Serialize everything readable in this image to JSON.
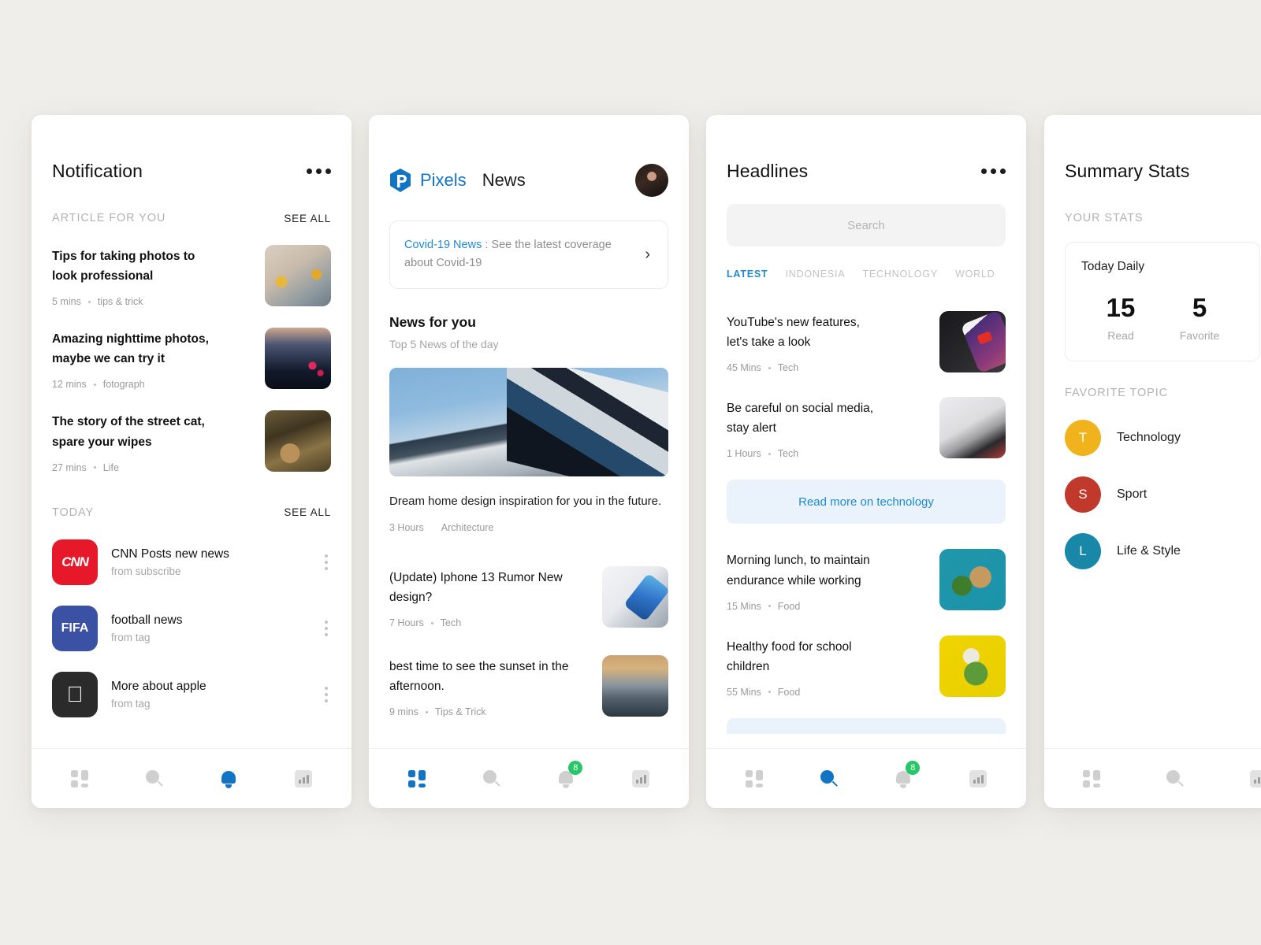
{
  "panel1": {
    "title": "Notification",
    "more_icon": "more-horizontal-icon",
    "sections": [
      {
        "label": "ARTICLE FOR YOU",
        "see_all": "SEE ALL"
      },
      {
        "label": "TODAY",
        "see_all": "SEE ALL"
      }
    ],
    "articles": [
      {
        "title": "Tips for taking photos to look professional",
        "time": "5 mins",
        "category": "tips & trick",
        "thumb": "sunflower-camera-photo"
      },
      {
        "title": "Amazing nighttime photos, maybe we can try it",
        "time": "12 mins",
        "category": "fotograph",
        "thumb": "night-city-phone-photo"
      },
      {
        "title": "The story of the street cat, spare your wipes",
        "time": "27 mins",
        "category": "Life",
        "thumb": "street-cat-photo"
      }
    ],
    "sources": [
      {
        "logo": "CNN",
        "logo_name": "cnn-logo",
        "title": "CNN Posts new news",
        "sub": "from subscribe"
      },
      {
        "logo": "FIFA",
        "logo_name": "fifa-logo",
        "title": "football news",
        "sub": "from tag"
      },
      {
        "logo": "",
        "logo_name": "apple-logo",
        "title": "More about apple",
        "sub": "from tag"
      }
    ],
    "nav": [
      {
        "icon": "grid-icon",
        "active": false,
        "badge": ""
      },
      {
        "icon": "search-icon",
        "active": false,
        "badge": ""
      },
      {
        "icon": "bell-icon",
        "active": true,
        "badge": ""
      },
      {
        "icon": "chart-icon",
        "active": false,
        "badge": ""
      }
    ]
  },
  "panel2": {
    "brand_logo": "pixels-hexagon-logo",
    "brand_first": "Pixels",
    "brand_second": "News",
    "avatar": "user-avatar",
    "covid": {
      "link": "Covid-19 News",
      "rest": " : See the latest coverage about Covid-19",
      "chevron": "chevron-right-icon"
    },
    "news_title": "News for you",
    "news_sub": "Top 5 News of the day",
    "hero": {
      "image": "modern-building-architecture-photo",
      "caption": "Dream home design inspiration for you in the future.",
      "time": "3 Hours",
      "category": "Architecture"
    },
    "articles": [
      {
        "title": "(Update) Iphone 13 Rumor New design?",
        "time": "7 Hours",
        "category": "Tech",
        "thumb": "iphone-on-laptop-photo"
      },
      {
        "title": "best time to see the sunset in the afternoon.",
        "time": "9 mins",
        "category": "Tips & Trick",
        "thumb": "sunset-mountains-photo"
      }
    ],
    "nav": [
      {
        "icon": "grid-icon",
        "active": true,
        "badge": ""
      },
      {
        "icon": "search-icon",
        "active": false,
        "badge": ""
      },
      {
        "icon": "bell-icon",
        "active": false,
        "badge": "8"
      },
      {
        "icon": "chart-icon",
        "active": false,
        "badge": ""
      }
    ]
  },
  "panel3": {
    "title": "Headlines",
    "more_icon": "more-horizontal-icon",
    "search_placeholder": "Search",
    "tabs": [
      {
        "label": "LATEST",
        "active": true
      },
      {
        "label": "INDONESIA",
        "active": false
      },
      {
        "label": "TECHNOLOGY",
        "active": false
      },
      {
        "label": "WORLD",
        "active": false
      }
    ],
    "articles_top": [
      {
        "title": "YouTube's new features, let's take a look",
        "time": "45 Mins",
        "category": "Tech",
        "thumb": "youtube-on-phone-photo"
      },
      {
        "title": "Be careful on social media, stay alert",
        "time": "1 Hours",
        "category": "Tech",
        "thumb": "social-media-tablet-photo"
      }
    ],
    "read_more_tech": "Read more on technology",
    "articles_bottom": [
      {
        "title": "Morning lunch, to maintain endurance while working",
        "time": "15 Mins",
        "category": "Food",
        "thumb": "lunch-box-photo"
      },
      {
        "title": "Healthy food for school children",
        "time": "55 Mins",
        "category": "Food",
        "thumb": "healthy-food-photo"
      }
    ],
    "nav": [
      {
        "icon": "grid-icon",
        "active": false,
        "badge": ""
      },
      {
        "icon": "search-icon",
        "active": true,
        "badge": ""
      },
      {
        "icon": "bell-icon",
        "active": false,
        "badge": "8"
      },
      {
        "icon": "chart-icon",
        "active": false,
        "badge": ""
      }
    ]
  },
  "panel4": {
    "title": "Summary Stats",
    "stats_label": "YOUR STATS",
    "card_title": "Today Daily",
    "stats": [
      {
        "value": "15",
        "caption": "Read"
      },
      {
        "value": "5",
        "caption": "Favorite"
      }
    ],
    "topic_label": "FAVORITE TOPIC",
    "topics": [
      {
        "initial": "T",
        "name": "Technology",
        "color": "#F0B31C"
      },
      {
        "initial": "S",
        "name": "Sport",
        "color": "#C0392B"
      },
      {
        "initial": "L",
        "name": "Life & Style",
        "color": "#1887A8"
      }
    ],
    "nav": [
      {
        "icon": "grid-icon",
        "active": false,
        "badge": ""
      },
      {
        "icon": "search-icon",
        "active": false,
        "badge": ""
      },
      {
        "icon": "chart-icon",
        "active": false,
        "badge": ""
      }
    ]
  },
  "colors": {
    "background": "#EFEEEA",
    "accent_blue": "#1174c4",
    "link_blue": "#1f8ad4",
    "badge_green": "#27C666",
    "banner_blue_bg": "#EAF3FB"
  }
}
